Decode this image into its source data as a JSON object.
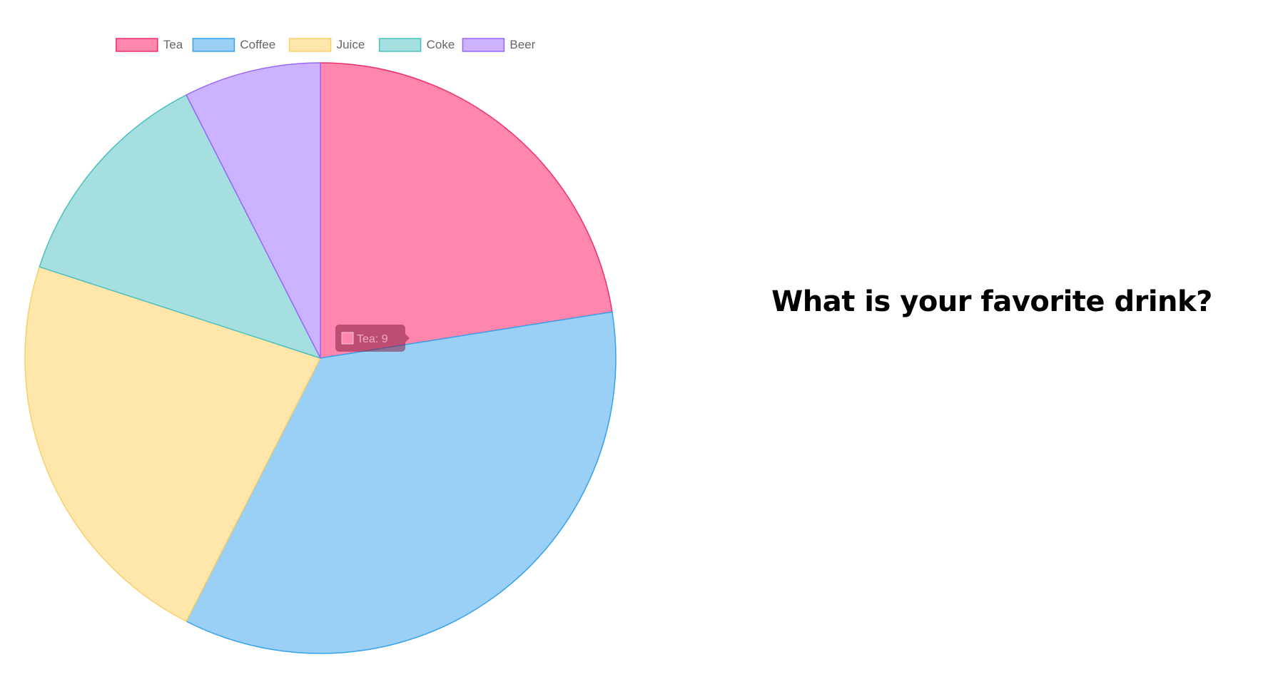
{
  "question": {
    "text": "What is your favorite drink?"
  },
  "chart_data": {
    "type": "pie",
    "categories": [
      "Tea",
      "Coffee",
      "Juice",
      "Coke",
      "Beer"
    ],
    "values": [
      9,
      14,
      9,
      5,
      3
    ],
    "colors": {
      "fill": [
        "#ff87ae",
        "#9ad0f5",
        "#ffe6aa",
        "#a5dfdf",
        "#ccb2ff"
      ],
      "border": [
        "#f0306a",
        "#36a2eb",
        "#f7d06a",
        "#4bc0c0",
        "#9966ff"
      ]
    },
    "legend": "top",
    "tooltip": {
      "label": "Tea: 9",
      "category_index": 0
    }
  }
}
